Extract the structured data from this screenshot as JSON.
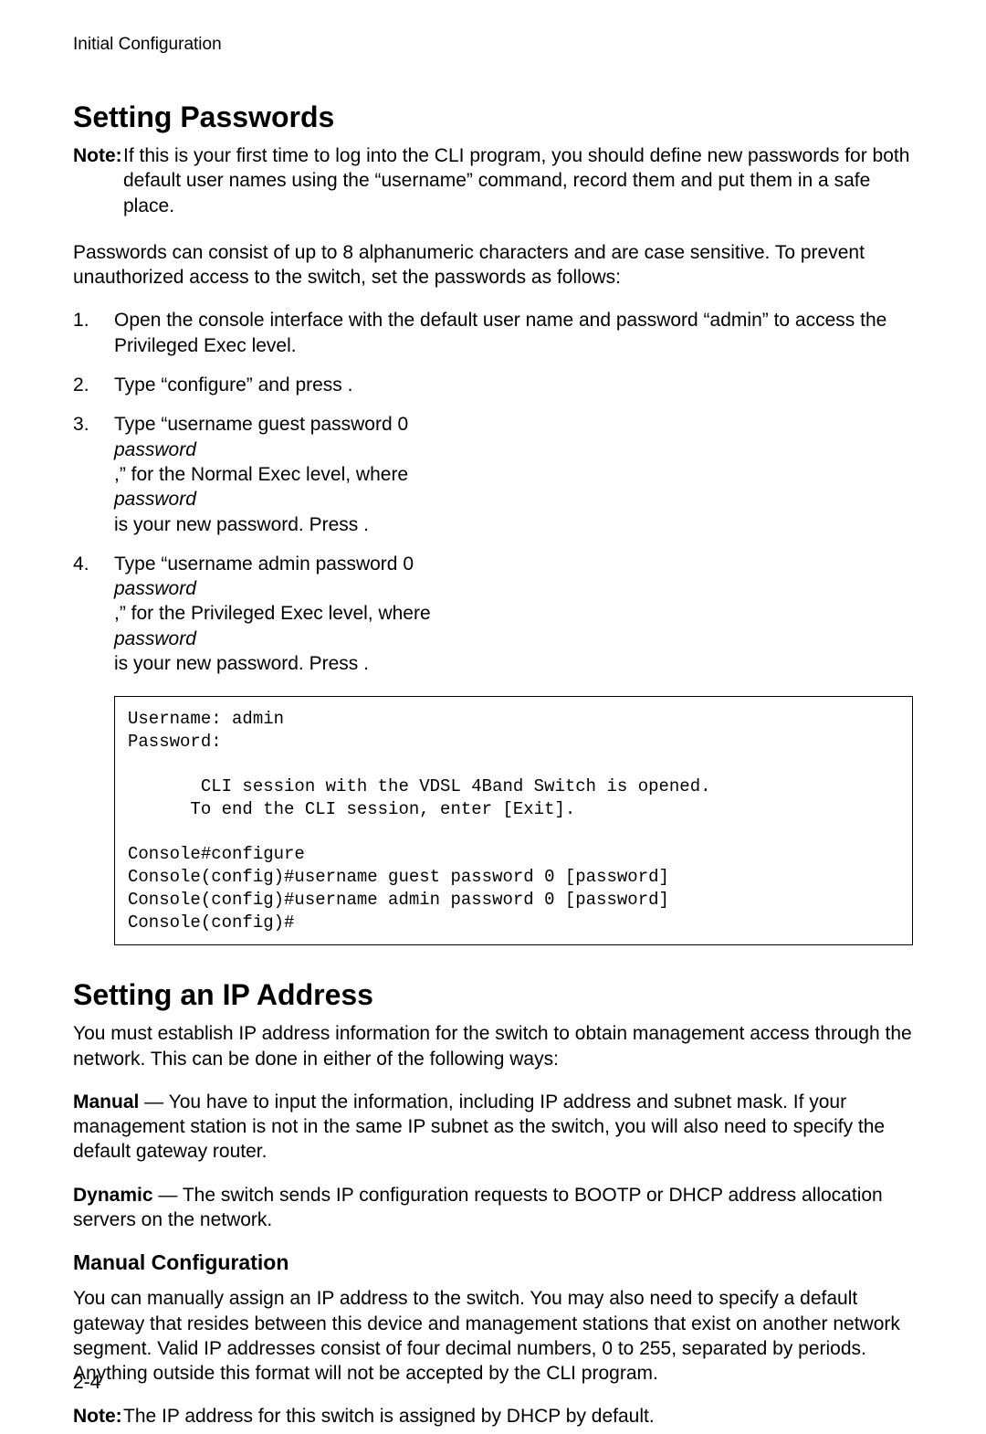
{
  "running_head": "Initial Configuration",
  "section1": {
    "title": "Setting Passwords",
    "note_label": "Note:",
    "note_body": "If this is your first time to log into the CLI program, you should define new passwords for both default user names using the “username” command, record them and put them in a safe place.",
    "intro": "Passwords can consist of up to 8 alphanumeric characters and are case sensitive. To prevent unauthorized access to the switch, set the passwords as follows:",
    "steps": [
      "Open the console interface with the default user name and password “admin” to access the Privileged Exec level.",
      "Type “configure” and press <Enter>.",
      "Type “username guest password 0 <i>password</i>,” for the Normal Exec level, where <i>password</i> is your new password. Press <Enter>.",
      "Type “username admin password 0 <i>password</i>,” for the Privileged Exec level, where <i>password</i> is your new password. Press <Enter>."
    ],
    "code": "Username: admin\nPassword:\n\n       CLI session with the VDSL 4Band Switch is opened.\n      To end the CLI session, enter [Exit].\n\nConsole#configure\nConsole(config)#username guest password 0 [password]\nConsole(config)#username admin password 0 [password]\nConsole(config)#"
  },
  "section2": {
    "title": "Setting an IP Address",
    "intro": "You must establish IP address information for the switch to obtain management access through the network. This can be done in either of the following ways:",
    "manual_label": "Manual",
    "manual_text": " — You have to input the information, including IP address and subnet mask. If your management station is not in the same IP subnet as the switch, you will also need to specify the default gateway router.",
    "dynamic_label": "Dynamic",
    "dynamic_text": " — The switch sends IP configuration requests to BOOTP or DHCP address allocation servers on the network.",
    "sub_title": "Manual Configuration",
    "sub_body": "You can manually assign an IP address to the switch. You may also need to specify a default gateway that resides between this device and management stations that exist on another network segment. Valid IP addresses consist of four decimal numbers, 0 to 255, separated by periods. Anything outside this format will not be accepted by the CLI program.",
    "note_label": "Note:",
    "note_body": "The IP address for this switch is assigned by DHCP by default."
  },
  "page_number": "2-4"
}
